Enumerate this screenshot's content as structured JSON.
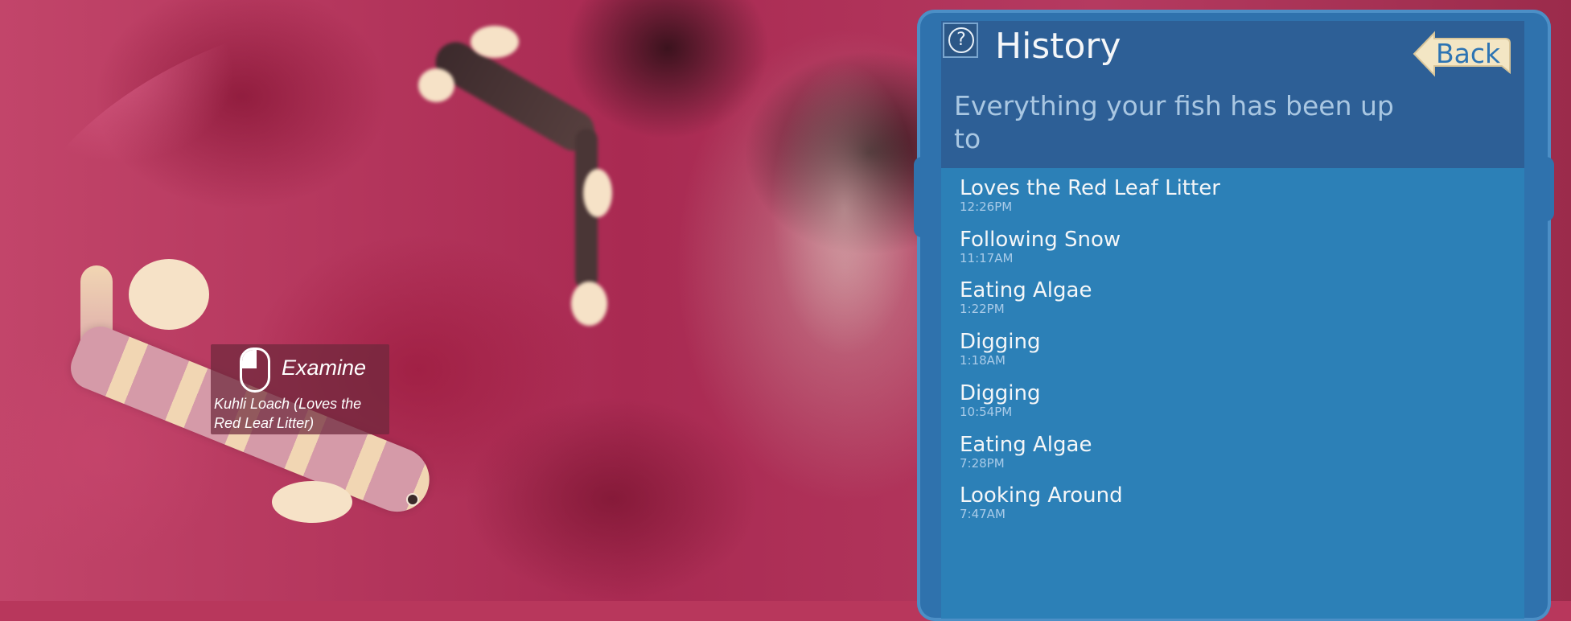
{
  "scene": {
    "examine_prompt": {
      "label": "Examine",
      "subject": "Kuhli Loach (Loves the Red Leaf Litter)"
    }
  },
  "history_panel": {
    "title": "History",
    "subtitle": "Everything your fish has been up to",
    "back_label": "Back",
    "help_icon": "question-circle-icon",
    "entries": [
      {
        "activity": "Loves the Red Leaf Litter",
        "time": "12:26PM"
      },
      {
        "activity": "Following Snow",
        "time": "11:17AM"
      },
      {
        "activity": "Eating Algae",
        "time": "1:22PM"
      },
      {
        "activity": "Digging",
        "time": "1:18AM"
      },
      {
        "activity": "Digging",
        "time": "10:54PM"
      },
      {
        "activity": "Eating Algae",
        "time": "7:28PM"
      },
      {
        "activity": "Looking Around",
        "time": "7:47AM"
      }
    ]
  }
}
